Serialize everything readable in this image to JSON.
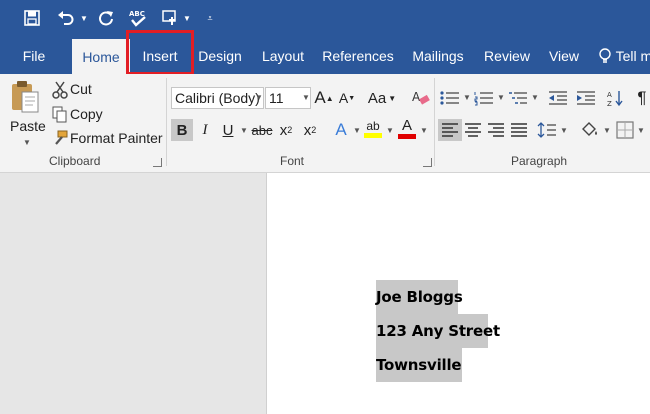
{
  "qat": {
    "icons": [
      "save-icon",
      "undo-icon",
      "redo-icon",
      "spelling-icon",
      "touch-mode-icon",
      "customize-qat-icon"
    ]
  },
  "tabs": [
    {
      "label": "File"
    },
    {
      "label": "Home"
    },
    {
      "label": "Insert"
    },
    {
      "label": "Design"
    },
    {
      "label": "Layout"
    },
    {
      "label": "References"
    },
    {
      "label": "Mailings"
    },
    {
      "label": "Review"
    },
    {
      "label": "View"
    },
    {
      "label": "Tell m"
    }
  ],
  "active_tab": "Home",
  "highlighted_tab": "Insert",
  "clipboard": {
    "paste_label": "Paste",
    "cut_label": "Cut",
    "copy_label": "Copy",
    "format_painter_label": "Format Painter",
    "group_label": "Clipboard"
  },
  "font": {
    "font_name": "Calibri (Body)",
    "font_size": "11",
    "grow_label": "A",
    "shrink_label": "A",
    "case_label": "Aa",
    "bold_label": "B",
    "italic_label": "I",
    "underline_label": "U",
    "strike_label": "abc",
    "subscript_label": "x",
    "subscript_mark": "2",
    "superscript_label": "x",
    "superscript_mark": "2",
    "text_effects_label": "A",
    "highlight_label": "ab",
    "font_color_label": "A",
    "group_label": "Font",
    "highlight_color": "#ffff00",
    "font_color": "#e00000"
  },
  "paragraph": {
    "group_label": "Paragraph"
  },
  "document": {
    "lines": [
      "Joe Bloggs",
      "123 Any Street",
      "Townsville"
    ]
  },
  "colors": {
    "brand": "#2b579a",
    "callout": "#e21e25",
    "selection": "#c8c8c8"
  }
}
